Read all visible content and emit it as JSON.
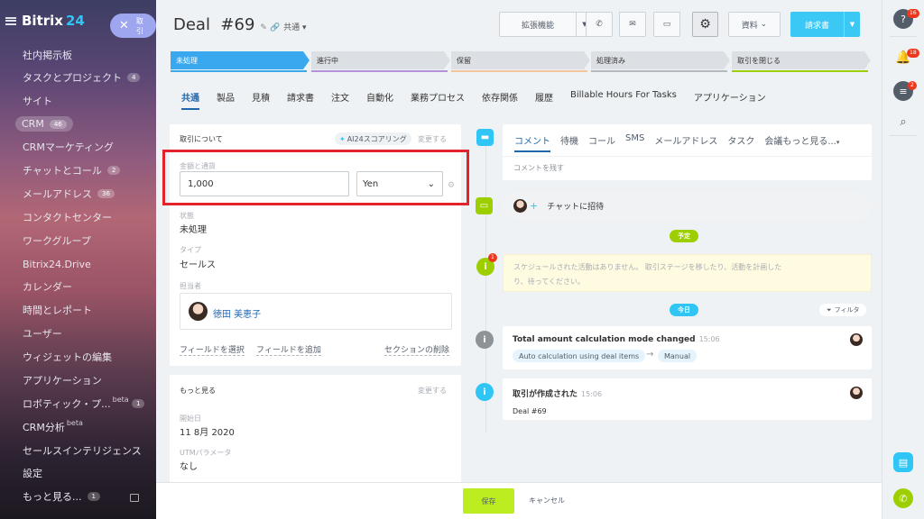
{
  "sidebar": {
    "brand": "Bitrix",
    "brand_num": "24",
    "close_label": "取引",
    "items": [
      {
        "label": "社内掲示板"
      },
      {
        "label": "タスクとプロジェクト",
        "count": "4"
      },
      {
        "label": "サイト"
      },
      {
        "label": "CRM",
        "count": "46"
      },
      {
        "label": "CRMマーケティング"
      },
      {
        "label": "チャットとコール",
        "count": "2"
      },
      {
        "label": "メールアドレス",
        "count": "36"
      },
      {
        "label": "コンタクトセンター"
      },
      {
        "label": "ワークグループ"
      },
      {
        "label": "Bitrix24.Drive"
      },
      {
        "label": "カレンダー"
      },
      {
        "label": "時間とレポート"
      },
      {
        "label": "ユーザー"
      },
      {
        "label": "ウィジェットの編集"
      },
      {
        "label": "アプリケーション"
      },
      {
        "label": "ロボティック・プ...",
        "beta": "beta",
        "count": "1"
      },
      {
        "label": "CRM分析",
        "beta": "beta"
      },
      {
        "label": "セールスインテリジェンス"
      },
      {
        "label": "設定"
      },
      {
        "label": "もっと見る...",
        "count": "1"
      }
    ]
  },
  "header": {
    "title": "Deal  #69",
    "shared": "共通",
    "ext_button": "拡張機能",
    "docs_button": "資料",
    "invoice_button": "請求書"
  },
  "stages": [
    {
      "label": "未処理",
      "active": true,
      "color": "#39a8ef"
    },
    {
      "label": "進行中",
      "color": "#b591d9"
    },
    {
      "label": "保留",
      "color": "#f3c49b"
    },
    {
      "label": "処理済み",
      "color": "#b4b9be"
    },
    {
      "label": "取引を閉じる",
      "color": "#9dcf00"
    }
  ],
  "tabs": [
    "共通",
    "製品",
    "見積",
    "請求書",
    "注文",
    "自動化",
    "業務プロセス",
    "依存関係",
    "履歴",
    "Billable Hours For Tasks",
    "アプリケーション"
  ],
  "deal_panel": {
    "heading": "取引について",
    "ai_tag": "AI24スコアリング",
    "change": "変更する",
    "amount_label": "金額と通貨",
    "amount_value": "1,000",
    "currency": "Yen",
    "status_label": "状態",
    "status_value": "未処理",
    "type_label": "タイプ",
    "type_value": "セールス",
    "owner_label": "担当者",
    "owner_name": "徳田 美恵子",
    "select_field": "フィールドを選択",
    "add_field": "フィールドを追加",
    "delete_section": "セクションの削除"
  },
  "more_panel": {
    "heading": "もっと見る",
    "change": "変更する",
    "start_label": "開始日",
    "start_value": "11 8月 2020",
    "utm_label": "UTMパラメータ",
    "utm_value": "なし"
  },
  "timeline": {
    "comment_tabs": [
      "コメント",
      "待機",
      "コール",
      "SMS",
      "メールアドレス",
      "タスク",
      "会議もっと見る..."
    ],
    "comment_placeholder": "コメントを残す",
    "invite": "チャットに招待",
    "planned_badge": "予定",
    "schedule_text_1": "スケジュールされた活動はありません。 取引ステージを移したり、活動を計画した",
    "schedule_text_2": "り、待ってください。",
    "schedule_badge": "1",
    "today_badge": "今日",
    "filter": "フィルタ",
    "event1": {
      "title": "Total amount calculation mode changed",
      "time": "15:06",
      "from": "Auto calculation using deal items",
      "arrow": "→",
      "to": "Manual"
    },
    "event2": {
      "title": "取引が作成された",
      "time": "15:06",
      "sub": "Deal #69"
    }
  },
  "rightbar": {
    "help_badge": "16",
    "bell_badge": "18",
    "chat_badge": "2"
  },
  "footer": {
    "save": "保存",
    "cancel": "キャンセル"
  }
}
